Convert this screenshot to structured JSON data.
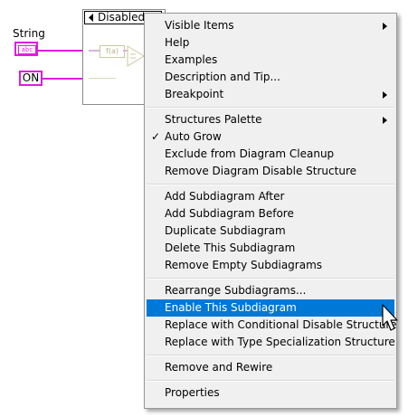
{
  "diagram": {
    "string_label": "String",
    "string_control_text": "abc",
    "on_control_text": "ON",
    "structure_selector_text": "Disabled",
    "format_node_text": "f(a)"
  },
  "menu": {
    "items": [
      {
        "label": "Visible Items",
        "submenu": true
      },
      {
        "label": "Help"
      },
      {
        "label": "Examples"
      },
      {
        "label": "Description and Tip..."
      },
      {
        "label": "Breakpoint",
        "submenu": true
      },
      {
        "label": "Structures Palette",
        "submenu": true
      },
      {
        "label": "Auto Grow",
        "checked": true
      },
      {
        "label": "Exclude from Diagram Cleanup"
      },
      {
        "label": "Remove Diagram Disable Structure"
      },
      {
        "label": "Add Subdiagram After"
      },
      {
        "label": "Add Subdiagram Before"
      },
      {
        "label": "Duplicate Subdiagram"
      },
      {
        "label": "Delete This Subdiagram"
      },
      {
        "label": "Remove Empty Subdiagrams"
      },
      {
        "label": "Rearrange Subdiagrams..."
      },
      {
        "label": "Enable This Subdiagram",
        "highlighted": true
      },
      {
        "label": "Replace with Conditional Disable Structure"
      },
      {
        "label": "Replace with Type Specialization Structure"
      },
      {
        "label": "Remove and Rewire"
      },
      {
        "label": "Properties"
      }
    ],
    "checkmark": "✓"
  },
  "colors": {
    "accent_highlight": "#0078d7",
    "wire_pink": "#e01ce0",
    "menu_bg": "#f0f0f0"
  }
}
